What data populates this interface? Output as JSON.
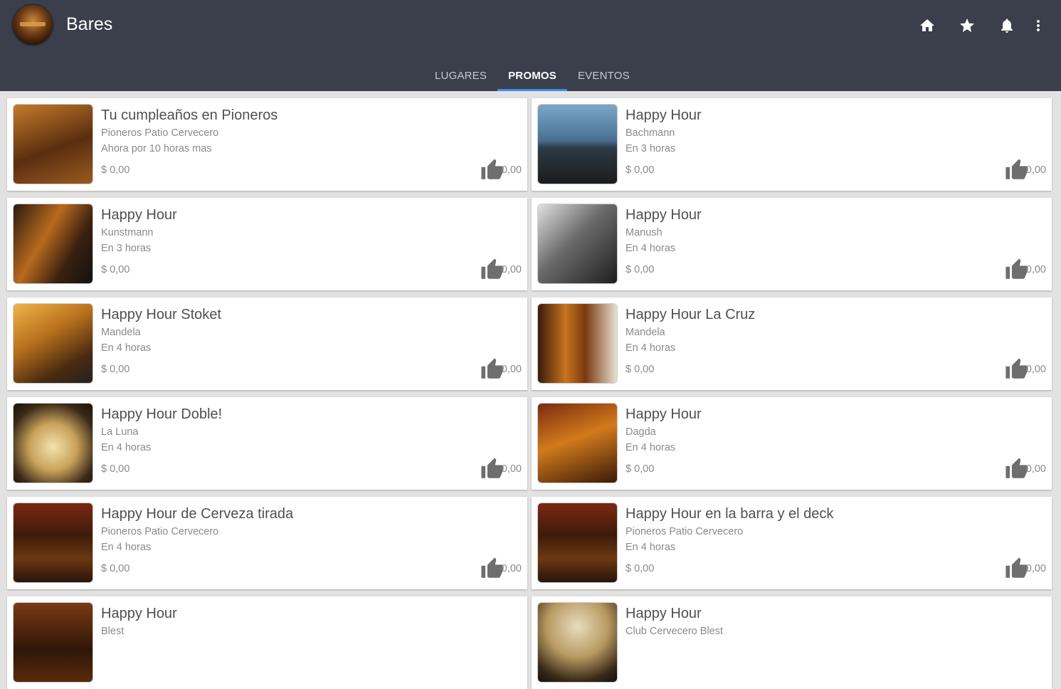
{
  "app": {
    "title": "Bares"
  },
  "actions": [
    {
      "icon": "home-icon"
    },
    {
      "icon": "star-icon"
    },
    {
      "icon": "bell-icon"
    },
    {
      "icon": "more-vert-icon"
    }
  ],
  "tabs": [
    {
      "label": "LUGARES",
      "active": false
    },
    {
      "label": "PROMOS",
      "active": true
    },
    {
      "label": "EVENTOS",
      "active": false
    }
  ],
  "colors": {
    "appbar": "#3a3f4b",
    "tab_indicator": "#3f8fe6",
    "background": "#e2e2e2"
  },
  "promos": [
    {
      "title": "Tu cumpleaños en Pioneros",
      "venue": "Pioneros Patio Cervecero",
      "time": "Ahora por 10 horas mas",
      "price": "$ 0,00",
      "likes": "0,00"
    },
    {
      "title": "Happy Hour",
      "venue": "Bachmann",
      "time": "En 3 horas",
      "price": "$ 0,00",
      "likes": "0,00"
    },
    {
      "title": "Happy Hour",
      "venue": "Kunstmann",
      "time": "En 3 horas",
      "price": "$ 0,00",
      "likes": "0,00"
    },
    {
      "title": "Happy Hour",
      "venue": "Manush",
      "time": "En 4 horas",
      "price": "$ 0,00",
      "likes": "0,00"
    },
    {
      "title": "Happy Hour Stoket",
      "venue": "Mandela",
      "time": "En 4 horas",
      "price": "$ 0,00",
      "likes": "0,00"
    },
    {
      "title": "Happy Hour La Cruz",
      "venue": "Mandela",
      "time": "En 4 horas",
      "price": "$ 0,00",
      "likes": "0,00"
    },
    {
      "title": "Happy Hour Doble!",
      "venue": "La Luna",
      "time": "En 4 horas",
      "price": "$ 0,00",
      "likes": "0,00"
    },
    {
      "title": "Happy Hour",
      "venue": "Dagda",
      "time": "En 4 horas",
      "price": "$ 0,00",
      "likes": "0,00"
    },
    {
      "title": "Happy Hour de Cerveza tirada",
      "venue": "Pioneros Patio Cervecero",
      "time": "En 4 horas",
      "price": "$ 0,00",
      "likes": "0,00"
    },
    {
      "title": "Happy Hour en la barra y el deck",
      "venue": "Pioneros Patio Cervecero",
      "time": "En 4 horas",
      "price": "$ 0,00",
      "likes": "0,00"
    },
    {
      "title": "Happy Hour",
      "venue": "Blest",
      "time": "",
      "price": "",
      "likes": ""
    },
    {
      "title": "Happy Hour",
      "venue": "Club Cervecero Blest",
      "time": "",
      "price": "",
      "likes": ""
    }
  ]
}
